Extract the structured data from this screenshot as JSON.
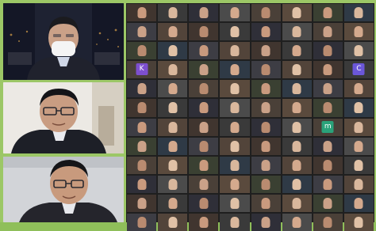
{
  "speakers": [
    {
      "label": "speaker-1"
    },
    {
      "label": "speaker-2"
    },
    {
      "label": "speaker-3"
    }
  ],
  "grid": {
    "tiles": [
      {
        "name": "",
        "letter": ""
      },
      {
        "name": "",
        "letter": ""
      },
      {
        "name": "",
        "letter": ""
      },
      {
        "name": "",
        "letter": ""
      },
      {
        "name": "",
        "letter": ""
      },
      {
        "name": "",
        "letter": ""
      },
      {
        "name": "",
        "letter": ""
      },
      {
        "name": "",
        "letter": ""
      },
      {
        "name": "",
        "letter": ""
      },
      {
        "name": "",
        "letter": ""
      },
      {
        "name": "",
        "letter": ""
      },
      {
        "name": "",
        "letter": ""
      },
      {
        "name": "",
        "letter": ""
      },
      {
        "name": "",
        "letter": ""
      },
      {
        "name": "",
        "letter": ""
      },
      {
        "name": "",
        "letter": ""
      },
      {
        "name": "",
        "letter": ""
      },
      {
        "name": "",
        "letter": ""
      },
      {
        "name": "",
        "letter": ""
      },
      {
        "name": "",
        "letter": ""
      },
      {
        "name": "",
        "letter": ""
      },
      {
        "name": "",
        "letter": ""
      },
      {
        "name": "",
        "letter": ""
      },
      {
        "name": "",
        "letter": ""
      },
      {
        "name": "",
        "letter": "K",
        "color": "#7d4fcf"
      },
      {
        "name": "",
        "letter": ""
      },
      {
        "name": "",
        "letter": ""
      },
      {
        "name": "",
        "letter": ""
      },
      {
        "name": "",
        "letter": ""
      },
      {
        "name": "",
        "letter": ""
      },
      {
        "name": "",
        "letter": ""
      },
      {
        "name": "",
        "letter": "C",
        "color": "#6b57d9"
      },
      {
        "name": "",
        "letter": ""
      },
      {
        "name": "",
        "letter": ""
      },
      {
        "name": "",
        "letter": ""
      },
      {
        "name": "",
        "letter": ""
      },
      {
        "name": "",
        "letter": ""
      },
      {
        "name": "",
        "letter": ""
      },
      {
        "name": "",
        "letter": ""
      },
      {
        "name": "",
        "letter": ""
      },
      {
        "name": "",
        "letter": ""
      },
      {
        "name": "",
        "letter": ""
      },
      {
        "name": "",
        "letter": ""
      },
      {
        "name": "",
        "letter": ""
      },
      {
        "name": "",
        "letter": ""
      },
      {
        "name": "",
        "letter": ""
      },
      {
        "name": "",
        "letter": ""
      },
      {
        "name": "",
        "letter": ""
      },
      {
        "name": "",
        "letter": ""
      },
      {
        "name": "",
        "letter": ""
      },
      {
        "name": "",
        "letter": ""
      },
      {
        "name": "",
        "letter": ""
      },
      {
        "name": "",
        "letter": ""
      },
      {
        "name": "",
        "letter": ""
      },
      {
        "name": "",
        "letter": "m",
        "color": "#2aa27a"
      },
      {
        "name": "",
        "letter": ""
      },
      {
        "name": "",
        "letter": ""
      },
      {
        "name": "",
        "letter": ""
      },
      {
        "name": "",
        "letter": ""
      },
      {
        "name": "",
        "letter": ""
      },
      {
        "name": "",
        "letter": ""
      },
      {
        "name": "",
        "letter": ""
      },
      {
        "name": "",
        "letter": ""
      },
      {
        "name": "",
        "letter": ""
      },
      {
        "name": "",
        "letter": ""
      },
      {
        "name": "",
        "letter": ""
      },
      {
        "name": "",
        "letter": ""
      },
      {
        "name": "",
        "letter": ""
      },
      {
        "name": "",
        "letter": ""
      },
      {
        "name": "",
        "letter": ""
      },
      {
        "name": "",
        "letter": ""
      },
      {
        "name": "",
        "letter": ""
      },
      {
        "name": "",
        "letter": ""
      },
      {
        "name": "",
        "letter": ""
      },
      {
        "name": "",
        "letter": ""
      },
      {
        "name": "",
        "letter": ""
      },
      {
        "name": "",
        "letter": ""
      },
      {
        "name": "",
        "letter": ""
      },
      {
        "name": "",
        "letter": ""
      },
      {
        "name": "",
        "letter": ""
      },
      {
        "name": "",
        "letter": ""
      },
      {
        "name": "",
        "letter": ""
      },
      {
        "name": "",
        "letter": ""
      },
      {
        "name": "",
        "letter": ""
      },
      {
        "name": "",
        "letter": ""
      },
      {
        "name": "",
        "letter": ""
      },
      {
        "name": "",
        "letter": ""
      },
      {
        "name": "",
        "letter": ""
      },
      {
        "name": "",
        "letter": ""
      },
      {
        "name": "",
        "letter": ""
      },
      {
        "name": "",
        "letter": ""
      },
      {
        "name": "",
        "letter": ""
      },
      {
        "name": "",
        "letter": ""
      },
      {
        "name": "",
        "letter": ""
      },
      {
        "name": "",
        "letter": ""
      },
      {
        "name": "",
        "letter": ""
      }
    ]
  }
}
